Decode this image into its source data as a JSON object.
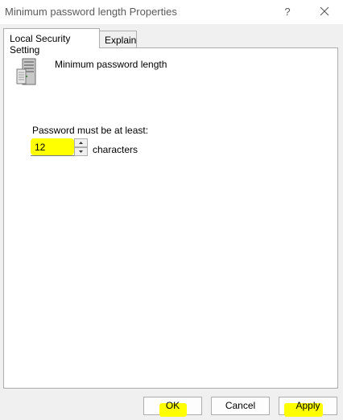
{
  "window": {
    "title": "Minimum password length Properties",
    "help_label": "?"
  },
  "tabs": [
    {
      "label": "Local Security Setting",
      "active": true
    },
    {
      "label": "Explain",
      "active": false
    }
  ],
  "setting": {
    "policy_name": "Minimum password length",
    "field_label": "Password must be at least:",
    "value": "12",
    "units_label": "characters"
  },
  "buttons": {
    "ok_label": "OK",
    "cancel_label": "Cancel",
    "apply_label": "Apply"
  },
  "colors": {
    "highlight": "#ffff00",
    "panel_background": "#ffffff",
    "dialog_background": "#f0f0f0"
  }
}
